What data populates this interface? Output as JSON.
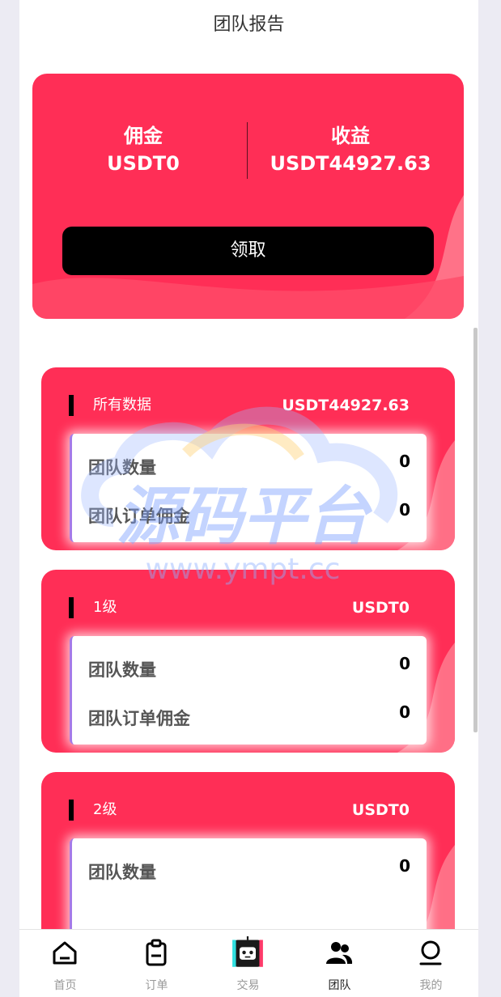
{
  "header": {
    "title": "团队报告"
  },
  "summary": {
    "commission_label": "佣金",
    "commission_value": "USDT0",
    "income_label": "收益",
    "income_value": "USDT44927.63",
    "claim_label": "领取"
  },
  "cards": [
    {
      "title": "所有数据",
      "amount": "USDT44927.63",
      "team_count_label": "团队数量",
      "team_count": "0",
      "order_commission_label": "团队订单佣金",
      "order_commission": "0"
    },
    {
      "title": "1级",
      "amount": "USDT0",
      "team_count_label": "团队数量",
      "team_count": "0",
      "order_commission_label": "团队订单佣金",
      "order_commission": "0"
    },
    {
      "title": "2级",
      "amount": "USDT0",
      "team_count_label": "团队数量",
      "team_count": "0"
    }
  ],
  "watermark": {
    "text": "源码平台",
    "url": "www.ympt.cc"
  },
  "tabbar": [
    {
      "label": "首页",
      "icon": "home-icon"
    },
    {
      "label": "订单",
      "icon": "clipboard-icon"
    },
    {
      "label": "交易",
      "icon": "robot-icon"
    },
    {
      "label": "团队",
      "icon": "team-icon",
      "active": true
    },
    {
      "label": "我的",
      "icon": "profile-icon"
    }
  ],
  "colors": {
    "primary": "#ff2e56",
    "button": "#000000",
    "inner_border": "#a57ae8"
  }
}
